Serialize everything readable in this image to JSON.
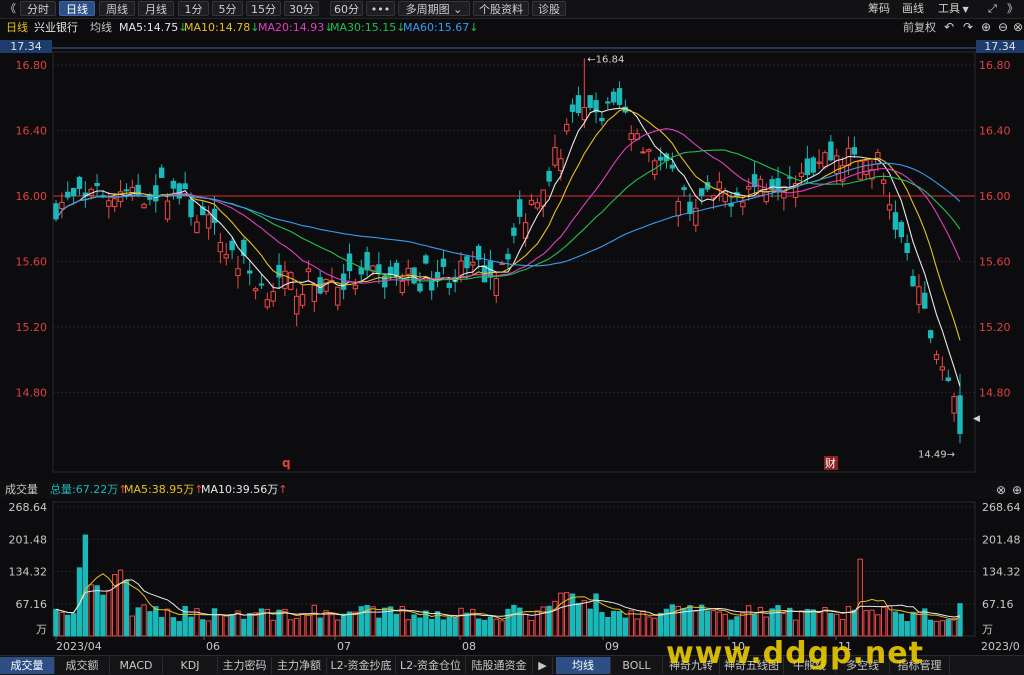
{
  "toolbar": {
    "nav_left": "《",
    "nav_right": "》",
    "buttons": [
      "分时",
      "日线",
      "周线",
      "月线",
      "1分",
      "5分",
      "15分",
      "30分",
      "60分",
      "•••",
      "多周期图",
      "个股资料",
      "诊股"
    ],
    "active": "日线",
    "right_items": [
      "筹码",
      "画线",
      "工具"
    ]
  },
  "header": {
    "period": "日线",
    "stock_name": "兴业银行",
    "avg_line_label": "均线",
    "ma": [
      {
        "label": "MA5:14.75",
        "arrow": "↓",
        "color": "#e8e8e8"
      },
      {
        "label": "MA10:14.78",
        "arrow": "↓",
        "color": "#e8c020"
      },
      {
        "label": "MA20:14.93",
        "arrow": "↓",
        "color": "#e040c0"
      },
      {
        "label": "MA30:15.15",
        "arrow": "↓",
        "color": "#20c050"
      },
      {
        "label": "MA60:15.67",
        "arrow": "↓",
        "color": "#3a9cf0"
      }
    ],
    "adjust_label": "前复权"
  },
  "price_axis": {
    "top_value": "17.34",
    "ticks": [
      "16.80",
      "16.40",
      "16.00",
      "15.60",
      "15.20",
      "14.80"
    ],
    "ref_line": "16.00",
    "max_label": "16.84",
    "min_label": "14.49",
    "markers": [
      "q",
      "财"
    ]
  },
  "x_axis": {
    "labels": [
      "2023/04",
      "06",
      "07",
      "08",
      "09",
      "10",
      "11"
    ],
    "right_label": "2023/0"
  },
  "volume_header": {
    "title": "成交量",
    "total": "总量:67.22万",
    "total_arrow": "↑",
    "ma5": "MA5:38.95万",
    "ma5_arrow": "↑",
    "ma10": "MA10:39.56万",
    "ma10_arrow": "↑"
  },
  "volume_axis": {
    "ticks": [
      "268.64",
      "201.48",
      "134.32",
      "67.16"
    ],
    "unit": "万"
  },
  "bottom_tabs": {
    "left": [
      "成交量",
      "成交额",
      "MACD",
      "KDJ",
      "主力密码",
      "主力净额",
      "L2-资金抄底",
      "L2-资金仓位",
      "陆股通资金"
    ],
    "left_active": "成交量",
    "right": [
      "均线",
      "BOLL",
      "神奇九转",
      "神奇五线图",
      "牛熊线",
      "多空线",
      "指标管理"
    ],
    "right_active": "均线",
    "scroll_arrow": "▶"
  },
  "watermark": "www.ddgp.net",
  "colors": {
    "up": "#f04848",
    "down": "#1ab8b8",
    "ma5": "#e8e8e8",
    "ma10": "#e8c020",
    "ma20": "#e040c0",
    "ma30": "#20c050",
    "ma60": "#3a9cf0"
  },
  "chart_data": {
    "type": "candlestick",
    "date_range": [
      "2023/04",
      "2023/11"
    ],
    "price_range": [
      14.49,
      17.34
    ],
    "anchors": [
      {
        "date": "2023/04",
        "close": 15.95
      },
      {
        "date": "2023/05",
        "close": 16.05
      },
      {
        "date": "2023/06",
        "close": 15.45
      },
      {
        "date": "2023/07",
        "close": 15.55
      },
      {
        "date": "2023/08",
        "close": 16.45
      },
      {
        "date": "2023/09",
        "close": 15.95
      },
      {
        "date": "2023/10",
        "close": 16.2
      },
      {
        "date": "2023/11",
        "close": 15.25
      },
      {
        "date": "2023/12",
        "close": 14.7
      }
    ],
    "period_high": 16.84,
    "period_low": 14.49,
    "volume_range": [
      0,
      268.64
    ],
    "volume_unit": "万"
  }
}
